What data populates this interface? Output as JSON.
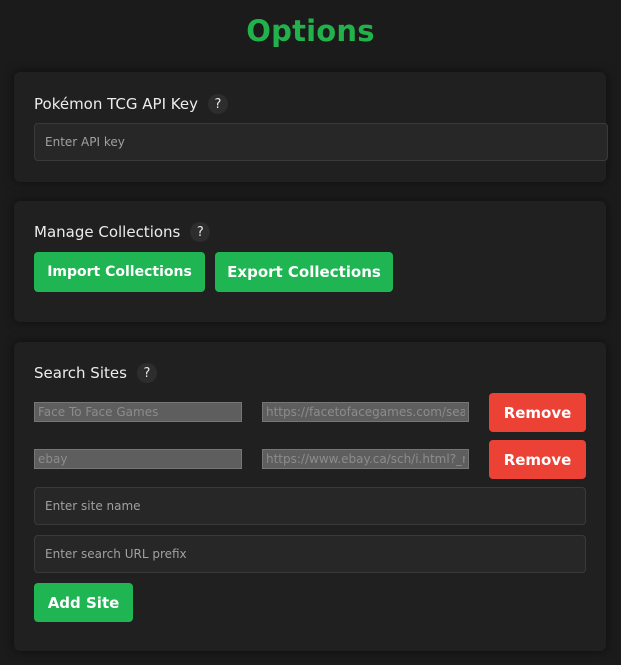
{
  "page": {
    "title": "Options"
  },
  "api_section": {
    "label": "Pokémon TCG API Key",
    "help": "?",
    "input_placeholder": "Enter API key",
    "input_value": ""
  },
  "collections_section": {
    "label": "Manage Collections",
    "help": "?",
    "import_label": "Import Collections",
    "export_label": "Export Collections"
  },
  "sites_section": {
    "label": "Search Sites",
    "help": "?",
    "sites": [
      {
        "name": "Face To Face Games",
        "url": "https://facetofacegames.com/search",
        "remove_label": "Remove"
      },
      {
        "name": "ebay",
        "url": "https://www.ebay.ca/sch/i.html?_nkw=",
        "remove_label": "Remove"
      }
    ],
    "site_name_placeholder": "Enter site name",
    "url_prefix_placeholder": "Enter search URL prefix",
    "add_label": "Add Site"
  },
  "colors": {
    "accent": "#22b24c",
    "button_green": "#1fb552",
    "button_red": "#ec4135",
    "background": "#1b1b1b",
    "card": "#202020"
  }
}
